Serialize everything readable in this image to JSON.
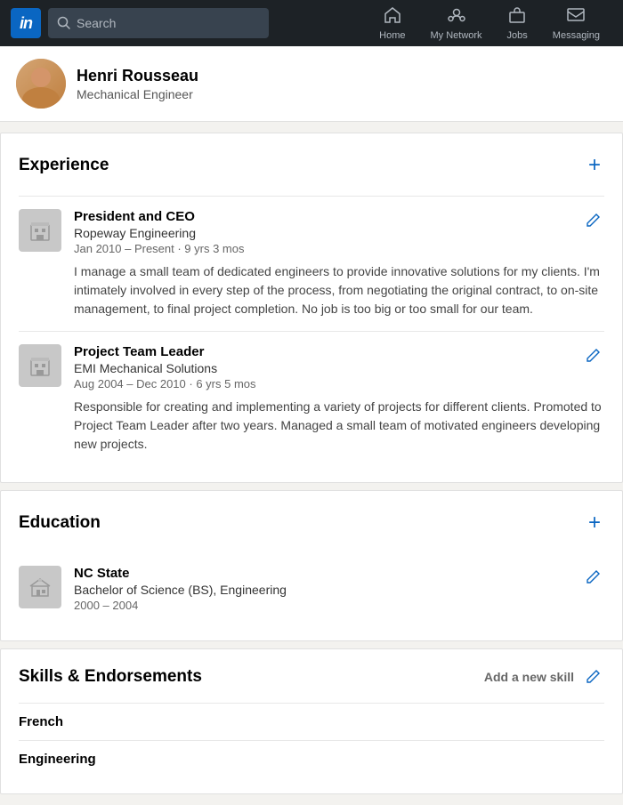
{
  "navbar": {
    "logo_text": "in",
    "search_placeholder": "Search",
    "nav_items": [
      {
        "id": "home",
        "label": "Home",
        "icon": "🏠"
      },
      {
        "id": "my-network",
        "label": "My Network",
        "icon": "👥"
      },
      {
        "id": "jobs",
        "label": "Jobs",
        "icon": "💼"
      },
      {
        "id": "messaging",
        "label": "Messaging",
        "icon": "💬"
      }
    ]
  },
  "profile": {
    "name": "Henri Rousseau",
    "title": "Mechanical Engineer"
  },
  "experience": {
    "section_title": "Experience",
    "add_label": "+",
    "items": [
      {
        "title": "President and CEO",
        "company": "Ropeway Engineering",
        "dates": "Jan 2010 – Present · 9 yrs 3 mos",
        "description": "I manage a small team of dedicated engineers to provide innovative solutions for my clients. I'm intimately involved in every step of the process, from negotiating the original contract, to on-site management, to final project completion. No job is too big or too small for our team."
      },
      {
        "title": "Project Team Leader",
        "company": "EMI Mechanical Solutions",
        "dates": "Aug 2004 – Dec 2010 · 6 yrs 5 mos",
        "description": "Responsible for creating and implementing a variety of projects for different clients. Promoted to Project Team Leader after two years. Managed a small team of motivated engineers developing new projects."
      }
    ]
  },
  "education": {
    "section_title": "Education",
    "add_label": "+",
    "items": [
      {
        "school": "NC State",
        "degree": "Bachelor of Science (BS), Engineering",
        "dates": "2000 – 2004"
      }
    ]
  },
  "skills": {
    "section_title": "Skills & Endorsements",
    "add_skill_label": "Add a new skill",
    "items": [
      {
        "name": "French"
      },
      {
        "name": "Engineering"
      }
    ]
  }
}
